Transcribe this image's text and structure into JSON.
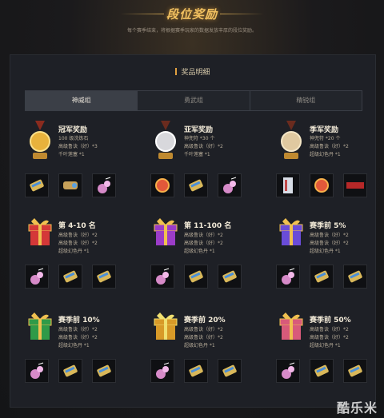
{
  "header": {
    "title": "段位奖励",
    "subtitle": "每个赛季结束，将根据赛季玩家的数据发放丰厚的段位奖励。"
  },
  "panel": {
    "title": "奖品明细",
    "tabs": [
      {
        "label": "神威组",
        "active": true
      },
      {
        "label": "勇武组",
        "active": false
      },
      {
        "label": "精锐组",
        "active": false
      }
    ]
  },
  "rewards": [
    {
      "name": "冠军奖励",
      "icon": "gold-medal-icon",
      "lines": [
        "100 级洗炼石",
        "高级鲁诀（好）*3",
        "千叶莲塞 *1"
      ],
      "items": [
        "scroll-icon",
        "orb-icon",
        "potion-icon"
      ]
    },
    {
      "name": "亚军奖励",
      "icon": "silver-medal-icon",
      "lines": [
        "神兜符 *30 个",
        "高级鲁诀（好）*2",
        "千叶莲塞 *1"
      ],
      "items": [
        "red-orb-icon",
        "scroll-icon",
        "potion-icon"
      ]
    },
    {
      "name": "季军奖励",
      "icon": "bronze-medal-icon",
      "lines": [
        "神兜符 *20 个",
        "高级鲁诀（好）*2",
        "超级幻色丹 *1"
      ],
      "items": [
        "card-icon",
        "red-orb-icon",
        "tag-icon"
      ]
    },
    {
      "name": "第 4-10 名",
      "icon": "red-gift-icon",
      "lines": [
        "高级鲁诀（好）*2",
        "高级鲁诀（好）*2",
        "超级幻色丹 *1"
      ],
      "items": [
        "potion-icon",
        "scroll-icon",
        "scroll-icon"
      ]
    },
    {
      "name": "第 11-100 名",
      "icon": "purple-gift-icon",
      "lines": [
        "高级鲁诀（好）*2",
        "高级鲁诀（好）*2",
        "超级幻色丹 *1"
      ],
      "items": [
        "potion-icon",
        "scroll-icon",
        "scroll-icon"
      ]
    },
    {
      "name": "赛季前 5%",
      "icon": "blue-gift-icon",
      "lines": [
        "高级鲁诀（好）*2",
        "高级鲁诀（好）*2",
        "超级幻色丹 *1"
      ],
      "items": [
        "potion-icon",
        "scroll-icon",
        "scroll-icon"
      ]
    },
    {
      "name": "赛季前 10%",
      "icon": "green-gift-icon",
      "lines": [
        "高级鲁诀（好）*2",
        "高级鲁诀（好）*2",
        "超级幻色丹 *1"
      ],
      "items": [
        "potion-icon",
        "scroll-icon",
        "scroll-icon"
      ]
    },
    {
      "name": "赛季前 20%",
      "icon": "gold-gift-icon",
      "lines": [
        "高级鲁诀（好）*2",
        "高级鲁诀（好）*2",
        "超级幻色丹 *1"
      ],
      "items": [
        "potion-icon",
        "scroll-icon",
        "scroll-icon"
      ]
    },
    {
      "name": "赛季前 50%",
      "icon": "pink-gift-icon",
      "lines": [
        "高级鲁诀（好）*2",
        "高级鲁诀（好）*2",
        "超级幻色丹 *1"
      ],
      "items": [
        "potion-icon",
        "scroll-icon",
        "scroll-icon"
      ]
    }
  ],
  "watermark": "酷乐米",
  "colors": {
    "accent": "#f0c060",
    "panel": "#1e2026",
    "tab_active": "#3b3f47"
  }
}
